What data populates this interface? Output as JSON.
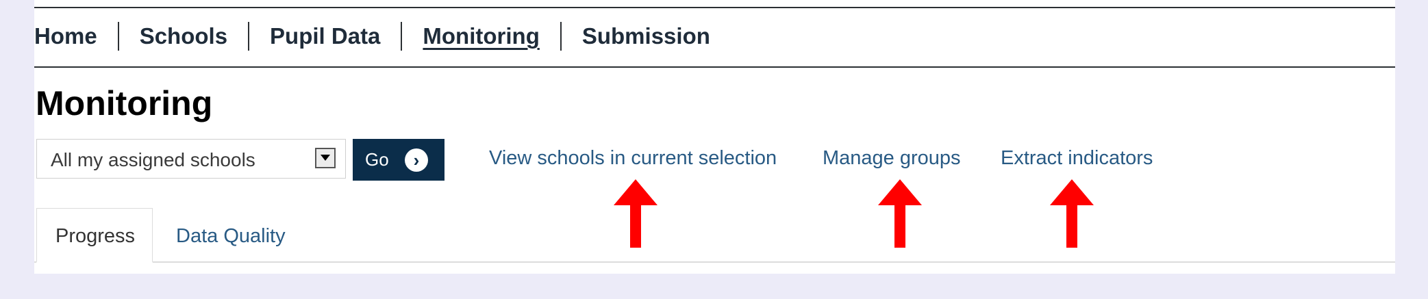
{
  "nav": {
    "items": [
      "Home",
      "Schools",
      "Pupil Data",
      "Monitoring",
      "Submission"
    ],
    "active": "Monitoring"
  },
  "page": {
    "title": "Monitoring"
  },
  "scope": {
    "selected": "All my assigned schools",
    "go_label": "Go"
  },
  "actions": [
    "View schools in current selection",
    "Manage groups",
    "Extract indicators"
  ],
  "tabs": [
    "Progress",
    "Data Quality"
  ],
  "colors": {
    "nav_text": "#1f2c3a",
    "link": "#285a84",
    "go_bg": "#0b2d4a",
    "arrow": "#ff0000",
    "background": "#ecebf8"
  }
}
